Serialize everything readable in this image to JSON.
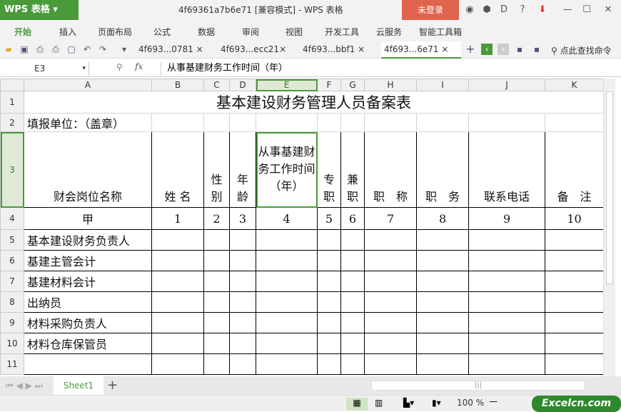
{
  "app": {
    "logo": "WPS 表格",
    "title": "4f69361a7b6e71 [兼容模式] - WPS 表格",
    "login": "未登录"
  },
  "menu": [
    "开始",
    "插入",
    "页面布局",
    "公式",
    "数据",
    "审阅",
    "视图",
    "开发工具",
    "云服务",
    "智能工具箱"
  ],
  "doc_tabs": [
    "4f693...0781",
    "4f693...ecc21",
    "4f693...bbf1",
    "4f693...6e71"
  ],
  "search_cmd": "点此查找命令",
  "formula_bar": {
    "cell": "E3",
    "fx": "fx",
    "value": "从事基建财务工作时间（年）"
  },
  "columns": [
    "A",
    "B",
    "C",
    "D",
    "E",
    "F",
    "G",
    "H",
    "I",
    "J",
    "K"
  ],
  "rows": [
    "1",
    "2",
    "3",
    "4",
    "5",
    "6",
    "7",
    "8",
    "9",
    "10",
    "11"
  ],
  "sheet": {
    "title": "基本建设财务管理人员备案表",
    "unit": "填报单位：（盖章）",
    "headers": [
      "财会岗位名称",
      "姓 名",
      "性别",
      "年龄",
      "从事基建财务工作时间（年）",
      "专职",
      "兼职",
      "职　称",
      "职　务",
      "联系电话",
      "备　注"
    ],
    "codes": [
      "甲",
      "1",
      "2",
      "3",
      "4",
      "5",
      "6",
      "7",
      "8",
      "9",
      "10"
    ],
    "positions": [
      "基本建设财务负责人",
      "基建主管会计",
      "基建材料会计",
      "出纳员",
      "材料采购负责人",
      "材料仓库保管员",
      ""
    ]
  },
  "sheet_tab": "Sheet1",
  "zoom": "100 %",
  "brand": "Excelcn.com"
}
